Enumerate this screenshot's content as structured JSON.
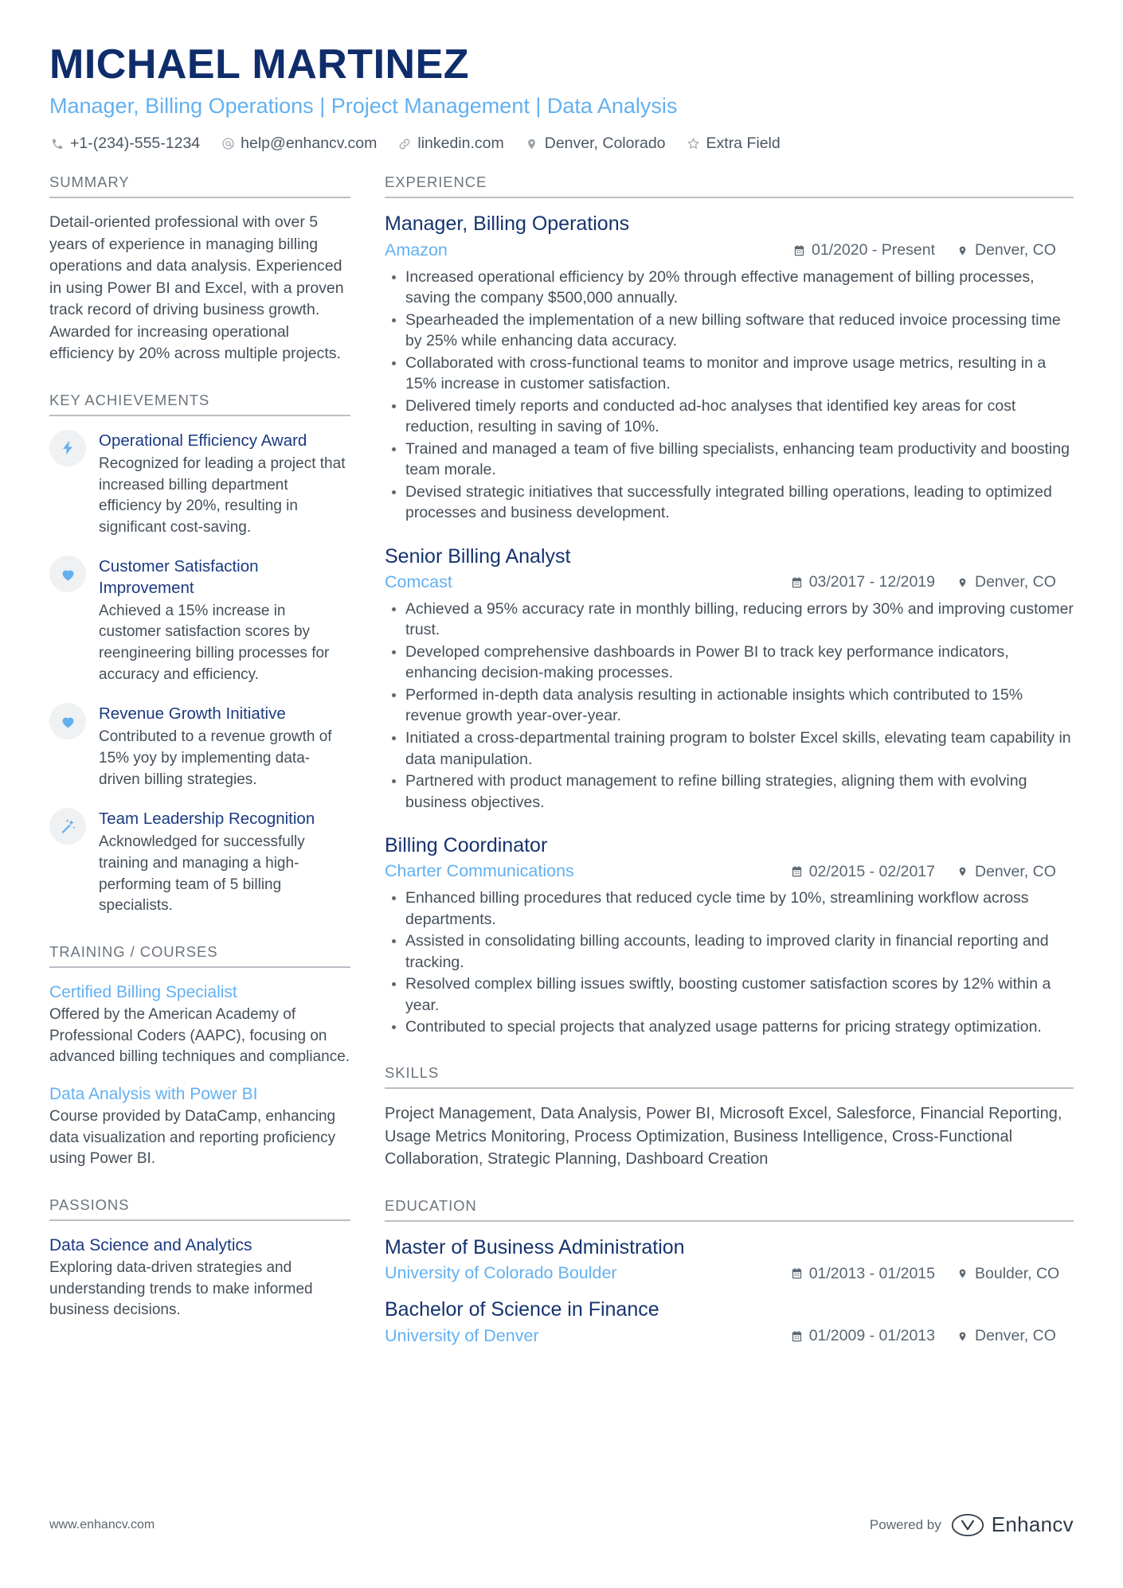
{
  "colors": {
    "name_navy": "#0f2d6b",
    "accent_blue": "#63b0f0",
    "heading_navy": "#16336f",
    "body_gray": "#454f59",
    "rule_gray": "#b9bfc5"
  },
  "header": {
    "name": "MICHAEL MARTINEZ",
    "role": "Manager, Billing Operations | Project Management | Data Analysis",
    "contacts": [
      {
        "icon": "phone-icon",
        "text": "+1-(234)-555-1234"
      },
      {
        "icon": "at-email-icon",
        "text": "help@enhancv.com"
      },
      {
        "icon": "link-icon",
        "text": "linkedin.com"
      },
      {
        "icon": "location-pin-icon",
        "text": "Denver, Colorado"
      },
      {
        "icon": "star-icon",
        "text": "Extra Field"
      }
    ]
  },
  "left": {
    "summary": {
      "title": "SUMMARY",
      "text": "Detail-oriented professional with over 5 years of experience in managing billing operations and data analysis. Experienced in using Power BI and Excel, with a proven track record of driving business growth. Awarded for increasing operational efficiency by 20% across multiple projects."
    },
    "achievements": {
      "title": "KEY ACHIEVEMENTS",
      "items": [
        {
          "icon": "lightning-bolt-icon",
          "title": "Operational Efficiency Award",
          "desc": "Recognized for leading a project that increased billing department efficiency by 20%, resulting in significant cost-saving."
        },
        {
          "icon": "heart-icon",
          "title": "Customer Satisfaction Improvement",
          "desc": "Achieved a 15% increase in customer satisfaction scores by reengineering billing processes for accuracy and efficiency."
        },
        {
          "icon": "heart-icon",
          "title": "Revenue Growth Initiative",
          "desc": "Contributed to a revenue growth of 15% yoy by implementing data-driven billing strategies."
        },
        {
          "icon": "magic-wand-icon",
          "title": "Team Leadership Recognition",
          "desc": "Acknowledged for successfully training and managing a high-performing team of 5 billing specialists."
        }
      ]
    },
    "training": {
      "title": "TRAINING / COURSES",
      "items": [
        {
          "title": "Certified Billing Specialist",
          "desc": "Offered by the American Academy of Professional Coders (AAPC), focusing on advanced billing techniques and compliance."
        },
        {
          "title": "Data Analysis with Power BI",
          "desc": "Course provided by DataCamp, enhancing data visualization and reporting proficiency using Power BI."
        }
      ]
    },
    "passions": {
      "title": "PASSIONS",
      "items": [
        {
          "title": "Data Science and Analytics",
          "desc": "Exploring data-driven strategies and understanding trends to make informed business decisions."
        }
      ]
    }
  },
  "right": {
    "experience": {
      "title": "EXPERIENCE",
      "jobs": [
        {
          "title": "Manager, Billing Operations",
          "company": "Amazon",
          "date": "01/2020 - Present",
          "location": "Denver, CO",
          "bullets": [
            "Increased operational efficiency by 20% through effective management of billing processes, saving the company $500,000 annually.",
            "Spearheaded the implementation of a new billing software that reduced invoice processing time by 25% while enhancing data accuracy.",
            "Collaborated with cross-functional teams to monitor and improve usage metrics, resulting in a 15% increase in customer satisfaction.",
            "Delivered timely reports and conducted ad-hoc analyses that identified key areas for cost reduction, resulting in saving of 10%.",
            "Trained and managed a team of five billing specialists, enhancing team productivity and boosting team morale.",
            "Devised strategic initiatives that successfully integrated billing operations, leading to optimized processes and business development."
          ]
        },
        {
          "title": "Senior Billing Analyst",
          "company": "Comcast",
          "date": "03/2017 - 12/2019",
          "location": "Denver, CO",
          "bullets": [
            "Achieved a 95% accuracy rate in monthly billing, reducing errors by 30% and improving customer trust.",
            "Developed comprehensive dashboards in Power BI to track key performance indicators, enhancing decision-making processes.",
            "Performed in-depth data analysis resulting in actionable insights which contributed to 15% revenue growth year-over-year.",
            "Initiated a cross-departmental training program to bolster Excel skills, elevating team capability in data manipulation.",
            "Partnered with product management to refine billing strategies, aligning them with evolving business objectives."
          ]
        },
        {
          "title": "Billing Coordinator",
          "company": "Charter Communications",
          "date": "02/2015 - 02/2017",
          "location": "Denver, CO",
          "bullets": [
            "Enhanced billing procedures that reduced cycle time by 10%, streamlining workflow across departments.",
            "Assisted in consolidating billing accounts, leading to improved clarity in financial reporting and tracking.",
            "Resolved complex billing issues swiftly, boosting customer satisfaction scores by 12% within a year.",
            "Contributed to special projects that analyzed usage patterns for pricing strategy optimization."
          ]
        }
      ]
    },
    "skills": {
      "title": "SKILLS",
      "text": "Project Management, Data Analysis, Power BI, Microsoft Excel, Salesforce, Financial Reporting, Usage Metrics Monitoring, Process Optimization, Business Intelligence, Cross-Functional Collaboration, Strategic Planning, Dashboard Creation"
    },
    "education": {
      "title": "EDUCATION",
      "items": [
        {
          "degree": "Master of Business Administration",
          "school": "University of Colorado Boulder",
          "date": "01/2013 - 01/2015",
          "location": "Boulder, CO"
        },
        {
          "degree": "Bachelor of Science in Finance",
          "school": "University of Denver",
          "date": "01/2009 - 01/2013",
          "location": "Denver, CO"
        }
      ]
    }
  },
  "footer": {
    "url": "www.enhancv.com",
    "powered_by": "Powered by",
    "brand": "Enhancv"
  }
}
